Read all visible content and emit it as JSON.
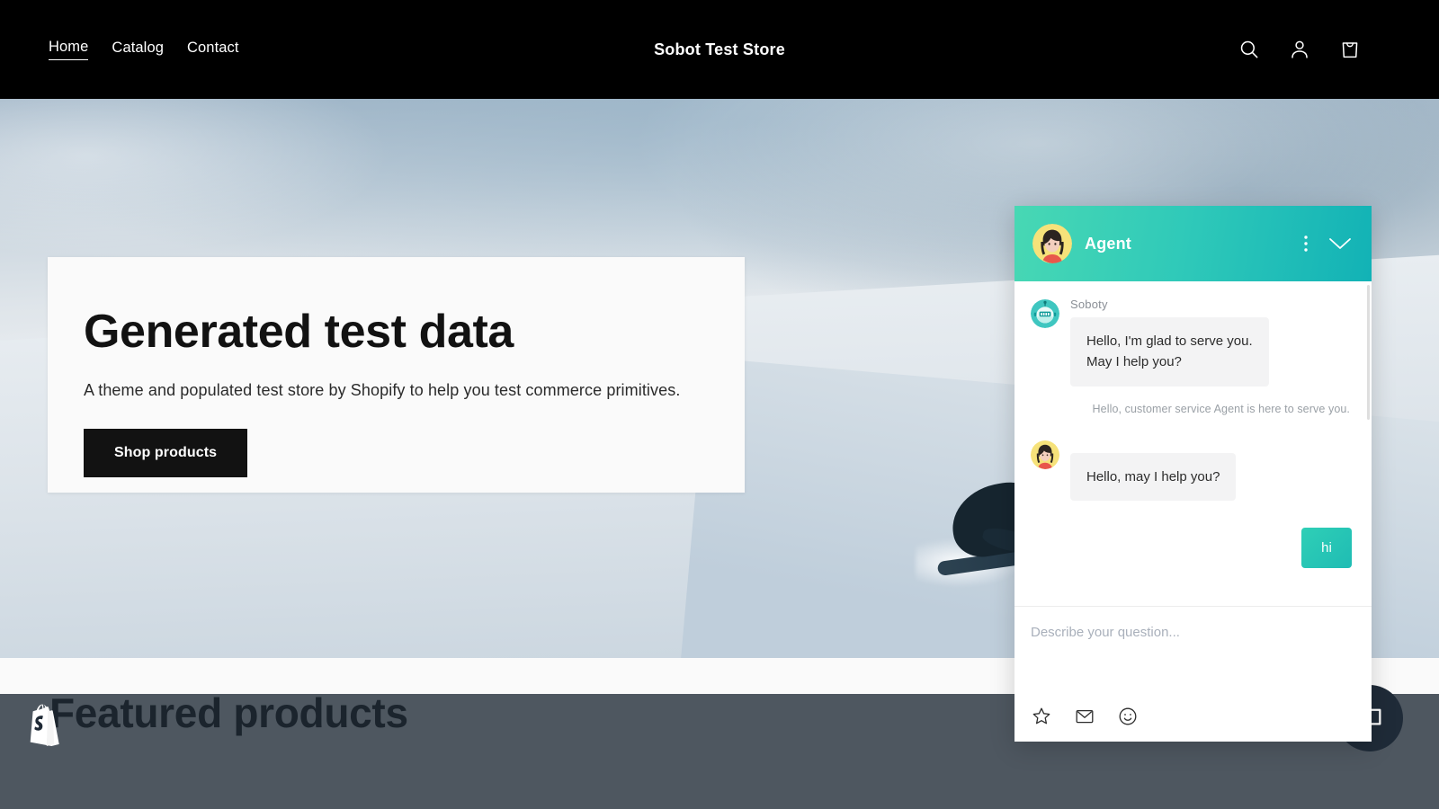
{
  "site": {
    "nav": [
      {
        "label": "Home",
        "active": true
      },
      {
        "label": "Catalog",
        "active": false
      },
      {
        "label": "Contact",
        "active": false
      }
    ],
    "store_title": "Sobot Test Store",
    "icons": {
      "search": "search-icon",
      "account": "account-icon",
      "cart": "shopping-bag-icon"
    }
  },
  "hero": {
    "heading": "Generated test data",
    "subheading": "A theme and populated test store by Shopify to help you test commerce primitives.",
    "cta_label": "Shop products"
  },
  "featured": {
    "heading": "Featured products"
  },
  "chat": {
    "header": {
      "title": "Agent",
      "avatar_name": "agent-avatar",
      "menu_icon": "kebab-menu-icon",
      "minimize_icon": "chevron-down-icon"
    },
    "messages": [
      {
        "kind": "incoming",
        "sender": "Soboty",
        "avatar": "bot-avatar",
        "lines": [
          "Hello, I'm glad to serve you.",
          "May I help you?"
        ]
      },
      {
        "kind": "system",
        "text": "Hello, customer service Agent is here to serve you."
      },
      {
        "kind": "incoming",
        "sender": "",
        "avatar": "agent-avatar",
        "lines": [
          "Hello, may I help you?"
        ]
      },
      {
        "kind": "outgoing",
        "text": "hi"
      }
    ],
    "input": {
      "value": "",
      "placeholder": "Describe your question..."
    },
    "toolbar": [
      {
        "icon": "star-icon",
        "label": "Rate"
      },
      {
        "icon": "envelope-icon",
        "label": "Leave message"
      },
      {
        "icon": "smiley-icon",
        "label": "Emoji"
      }
    ]
  },
  "launcher": {
    "icon": "chat-launcher-icon"
  },
  "colors": {
    "nav_background": "#000000",
    "chat_accent_start": "#48d8b4",
    "chat_accent_end": "#12b2b6",
    "cta_background": "#121212",
    "bubble_incoming": "#f3f3f4",
    "overlay": "#1e2935"
  }
}
